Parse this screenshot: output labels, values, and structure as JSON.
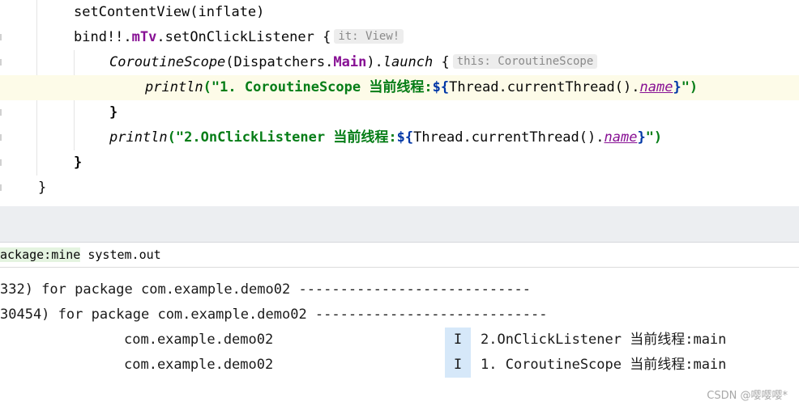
{
  "editor": {
    "line1": "setContentView(inflate)",
    "line2_a": "bind!!.",
    "line2_b": "mTv",
    "line2_c": ".setOnClickListener {",
    "line2_hint": "it: View!",
    "line3_a": "CoroutineScope",
    "line3_b": "(Dispatchers.",
    "line3_c": "Main",
    "line3_d": ").",
    "line3_e": "launch",
    "line3_f": " {",
    "line3_hint": "this: CoroutineScope",
    "line4_fn": "println",
    "line4_str": "(\"1. CoroutineScope 当前线程:",
    "line4_tmpl_open": "${",
    "line4_expr": "Thread.currentThread().",
    "line4_prop": "name",
    "line4_tmpl_close": "}",
    "line4_end": "\")",
    "line5": "}",
    "line6_fn": "println",
    "line6_str": "(\"2.OnClickListener 当前线程:",
    "line6_tmpl_open": "${",
    "line6_expr": "Thread.currentThread().",
    "line6_prop": "name",
    "line6_tmpl_close": "}",
    "line6_end": "\")",
    "line7": "}",
    "line8": "}"
  },
  "filter": {
    "chip": "ackage:mine",
    "rest": " system.out"
  },
  "log": {
    "header1": "332) for package com.example.demo02 ----------------------------",
    "header2": "30454) for package com.example.demo02 ----------------------------",
    "entries": [
      {
        "package": "com.example.demo02",
        "level": "I",
        "message": "2.OnClickListener 当前线程:main"
      },
      {
        "package": "com.example.demo02",
        "level": "I",
        "message": "1. CoroutineScope 当前线程:main"
      }
    ]
  },
  "watermark": "CSDN @嘤嘤嘤*"
}
